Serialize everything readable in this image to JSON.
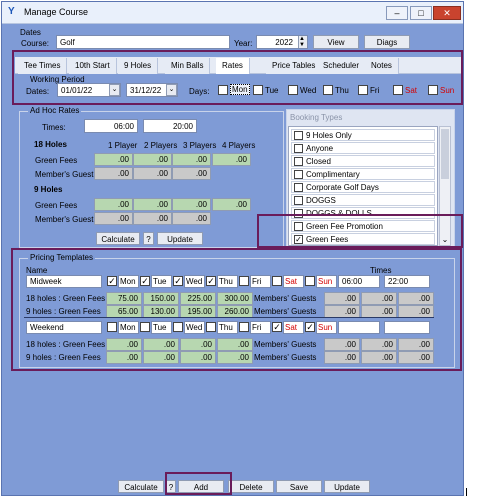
{
  "window": {
    "title": "Manage Course",
    "icon": "Y"
  },
  "dates_group": {
    "title": "Dates",
    "course_label": "Course:",
    "course_value": "Golf",
    "year_label": "Year:",
    "year_value": "2022",
    "view_btn": "View",
    "diags_btn": "Diags"
  },
  "tabs": [
    "Tee Times",
    "10th Start",
    "9 Holes",
    "Min Balls",
    "Rates",
    "Price Tables",
    "Scheduler",
    "Notes"
  ],
  "working_period": {
    "title": "Working Period",
    "dates_label": "Dates:",
    "start": "01/01/22",
    "end": "31/12/22",
    "days_label": "Days:",
    "days": [
      {
        "label": "Mon",
        "red": false
      },
      {
        "label": "Tue",
        "red": false
      },
      {
        "label": "Wed",
        "red": false
      },
      {
        "label": "Thu",
        "red": false
      },
      {
        "label": "Fri",
        "red": false
      },
      {
        "label": "Sat",
        "red": true
      },
      {
        "label": "Sun",
        "red": true
      }
    ]
  },
  "adhoc": {
    "title": "Ad Hoc Rates",
    "times_label": "Times:",
    "time_from": "06:00",
    "time_to": "20:00",
    "holes18": "18 Holes",
    "holes9": "9  Holes",
    "players": [
      "1 Player",
      "2 Players",
      "3 Players",
      "4 Players"
    ],
    "green_fees": "Green Fees",
    "members_guest": "Member's Guest",
    "zero": ".00",
    "calculate": "Calculate",
    "help": "?",
    "update": "Update"
  },
  "booking_types": {
    "title": "Booking Types",
    "items": [
      {
        "label": "9 Holes Only",
        "checked": false
      },
      {
        "label": "Anyone",
        "checked": false
      },
      {
        "label": "Closed",
        "checked": false
      },
      {
        "label": "Complimentary",
        "checked": false
      },
      {
        "label": "Corporate Golf Days",
        "checked": false
      },
      {
        "label": "DOGGS",
        "checked": false
      },
      {
        "label": "DOGGS & DOLLS",
        "checked": false
      },
      {
        "label": "Green Fee Promotion",
        "checked": false
      },
      {
        "label": "Green Fees",
        "checked": true
      }
    ]
  },
  "pricing": {
    "title": "Pricing Templates",
    "name_header": "Name",
    "times_header": "Times",
    "row18_label": "18 holes : Green Fees",
    "row9_label": "9 holes : Green Fees",
    "members_guests": "Members' Guests",
    "zero": ".00",
    "templates": [
      {
        "name": "Midweek",
        "days": [
          {
            "label": "Mon",
            "checked": true,
            "red": false
          },
          {
            "label": "Tue",
            "checked": true,
            "red": false
          },
          {
            "label": "Wed",
            "checked": true,
            "red": false
          },
          {
            "label": "Thu",
            "checked": true,
            "red": false
          },
          {
            "label": "Fri",
            "checked": false,
            "red": false
          },
          {
            "label": "Sat",
            "checked": false,
            "red": true
          },
          {
            "label": "Sun",
            "checked": false,
            "red": true
          }
        ],
        "time_from": "06:00",
        "time_to": "22:00",
        "fees18": [
          "75.00",
          "150.00",
          "225.00",
          "300.00"
        ],
        "fees9": [
          "65.00",
          "130.00",
          "195.00",
          "260.00"
        ]
      },
      {
        "name": "Weekend",
        "days": [
          {
            "label": "Mon",
            "checked": false,
            "red": false
          },
          {
            "label": "Tue",
            "checked": false,
            "red": false
          },
          {
            "label": "Wed",
            "checked": false,
            "red": false
          },
          {
            "label": "Thu",
            "checked": false,
            "red": false
          },
          {
            "label": "Fri",
            "checked": false,
            "red": false
          },
          {
            "label": "Sat",
            "checked": true,
            "red": true
          },
          {
            "label": "Sun",
            "checked": true,
            "red": true
          }
        ],
        "time_from": "",
        "time_to": "",
        "fees18": [
          ".00",
          ".00",
          ".00",
          ".00"
        ],
        "fees9": [
          ".00",
          ".00",
          ".00",
          ".00"
        ]
      }
    ]
  },
  "bottom": {
    "calculate": "Calculate",
    "help": "?",
    "add": "Add",
    "delete": "Delete",
    "save": "Save",
    "update": "Update"
  },
  "colors": {
    "window_bg": "#7f9bd6",
    "highlight": "#6a1c5a",
    "green_cell": "#b7d7b0",
    "grey_cell": "#c9c9c9",
    "red_text": "#d40000"
  }
}
